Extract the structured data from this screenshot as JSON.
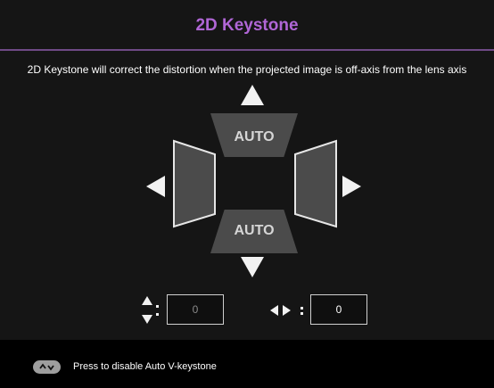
{
  "header": {
    "title": "2D Keystone"
  },
  "description": "2D Keystone will correct the distortion when the projected image is off-axis from the lens axis",
  "keystone": {
    "top_label": "AUTO",
    "bottom_label": "AUTO",
    "vertical_value": "0",
    "horizontal_value": "0"
  },
  "footer": {
    "button_icon": "up-down-chevrons-icon",
    "text": "Press to disable Auto V-keystone"
  },
  "colors": {
    "title": "#b066d6",
    "divider": "#6f4a86",
    "background": "#151515",
    "footer_bg": "#000000",
    "shape": "#4b4b4b"
  }
}
